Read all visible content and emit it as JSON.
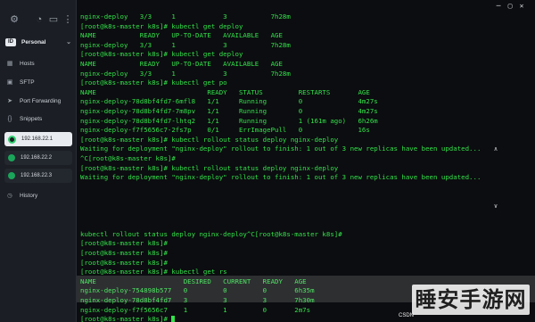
{
  "sidebar": {
    "section_badge": "ID",
    "section_label": "Personal",
    "nav": [
      {
        "icon": "hosts-icon",
        "glyph": "▦",
        "label": "Hosts"
      },
      {
        "icon": "sftp-icon",
        "glyph": "▣",
        "label": "SFTP"
      },
      {
        "icon": "port-forwarding-icon",
        "glyph": "➤",
        "label": "Port Forwarding"
      },
      {
        "icon": "snippets-icon",
        "glyph": "{}",
        "label": "Snippets"
      }
    ],
    "hosts": [
      {
        "label": "192.168.22.1",
        "active": true
      },
      {
        "label": "192.168.22.2",
        "active": false
      },
      {
        "label": "192.168.22.3",
        "active": false
      }
    ],
    "history_label": "History"
  },
  "terminal": {
    "lines": [
      "nginx-deploy   3/3     1            3           7h28m",
      "[root@k8s-master k8s]# kubectl get deploy",
      "NAME           READY   UP-TO-DATE   AVAILABLE   AGE",
      "nginx-deploy   3/3     1            3           7h28m",
      "[root@k8s-master k8s]# kubectl get deploy",
      "NAME           READY   UP-TO-DATE   AVAILABLE   AGE",
      "nginx-deploy   3/3     1            3           7h28m",
      "[root@k8s-master k8s]# kubectl get po",
      "NAME                            READY   STATUS         RESTARTS       AGE",
      "nginx-deploy-78d8bf4fd7-6mfl8   1/1     Running        0              4m27s",
      "nginx-deploy-78d8bf4fd7-7m8pv   1/1     Running        0              4m27s",
      "nginx-deploy-78d8bf4fd7-lhtq2   1/1     Running        1 (161m ago)   6h26m",
      "nginx-deploy-f7f5656c7-2fs7p    0/1     ErrImagePull   0              16s",
      "[root@k8s-master k8s]# kubectl rollout status deploy nginx-deploy",
      "Waiting for deployment \"nginx-deploy\" rollout to finish: 1 out of 3 new replicas have been updated...",
      "^C[root@k8s-master k8s]#",
      "[root@k8s-master k8s]# kubectl rollout status deploy nginx-deploy",
      "Waiting for deployment \"nginx-deploy\" rollout to finish: 1 out of 3 new replicas have been updated...",
      "",
      "",
      "",
      "",
      "",
      "kubectl rollout status deploy nginx-deploy^C[root@k8s-master k8s]#",
      "[root@k8s-master k8s]#",
      "[root@k8s-master k8s]#",
      "[root@k8s-master k8s]#",
      "[root@k8s-master k8s]# kubectl get rs",
      "NAME                      DESIRED   CURRENT   READY   AGE",
      "nginx-deploy-754898b577   0         0         0       6h35m",
      "nginx-deploy-78d8bf4fd7   3         3         3       7h30m",
      "nginx-deploy-f7f5656c7    1         1         0       2m7s",
      "[root@k8s-master k8s]# "
    ]
  },
  "watermark": "睡安手游网",
  "csdn": "CSDN"
}
